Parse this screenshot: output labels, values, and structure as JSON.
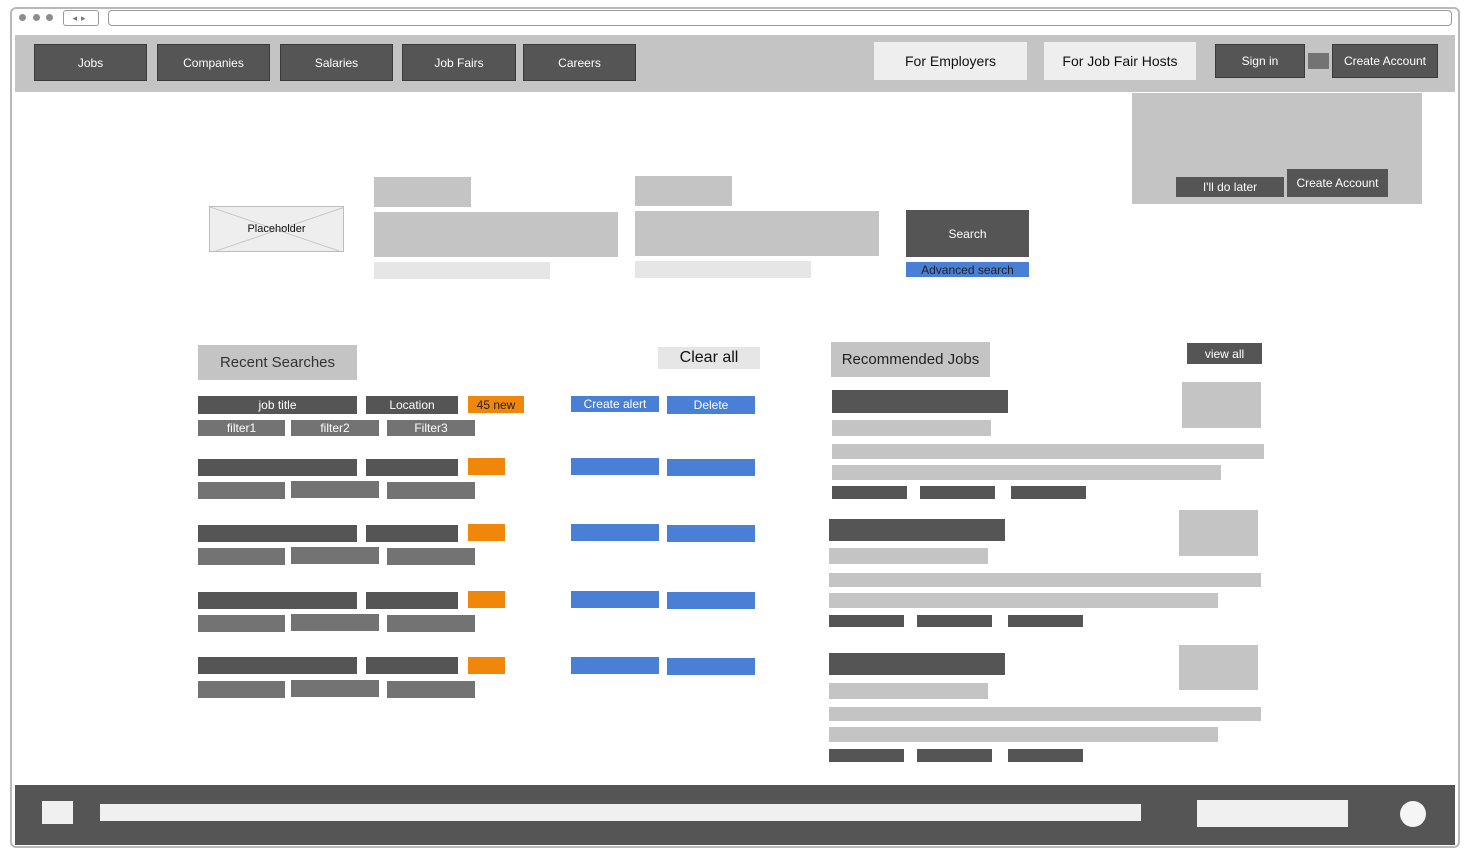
{
  "nav": {
    "items": [
      {
        "label": "Jobs"
      },
      {
        "label": "Companies"
      },
      {
        "label": "Salaries"
      },
      {
        "label": "Job Fairs"
      },
      {
        "label": "Careers"
      }
    ],
    "for_employers": "For Employers",
    "for_job_fair_hosts": "For Job Fair Hosts",
    "sign_in": "Sign in",
    "create_account": "Create Account"
  },
  "signup_prompt": {
    "later_label": "I'll do later",
    "create_label": "Create Account"
  },
  "search": {
    "logo_placeholder": "Placeholder",
    "search_label": "Search",
    "advanced_label": "Advanced search"
  },
  "recent_searches": {
    "title": "Recent Searches",
    "clear_all": "Clear all",
    "first_row": {
      "job_title": "job title",
      "location": "Location",
      "new_badge": "45 new",
      "filters": [
        "filter1",
        "filter2",
        "Filter3"
      ],
      "create_alert": "Create alert",
      "delete": "Delete"
    }
  },
  "recommended": {
    "title": "Recommended Jobs",
    "view_all": "view all"
  },
  "colors": {
    "dark": "#555555",
    "gray": "#c4c4c4",
    "blue": "#4a7fd6",
    "orange": "#f0870a"
  }
}
